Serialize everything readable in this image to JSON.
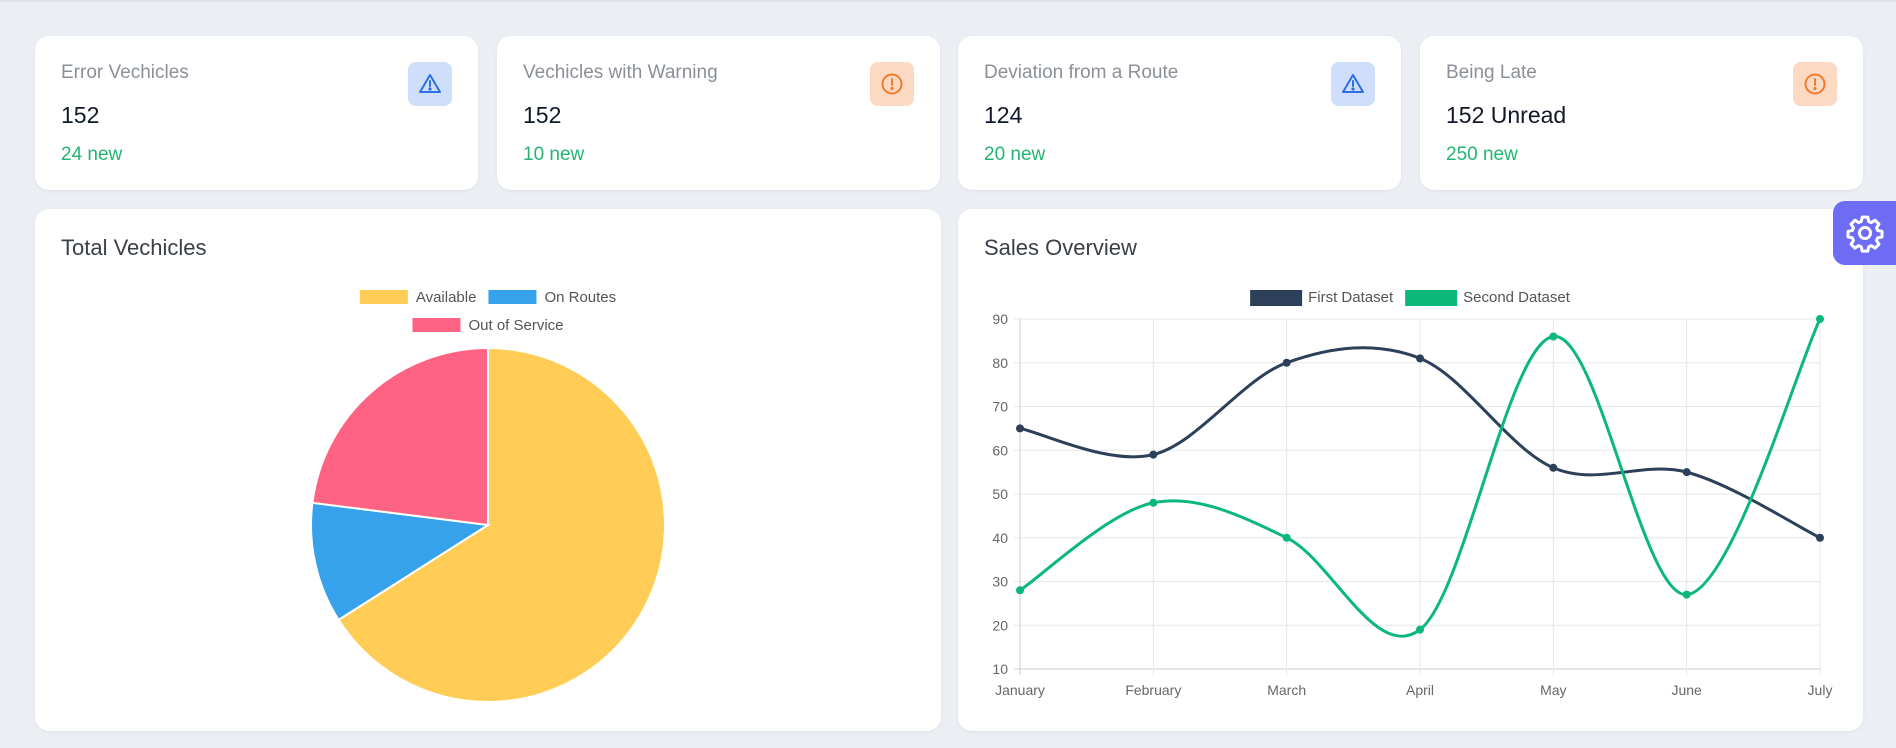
{
  "stats": [
    {
      "title": "Error Vechicles",
      "value": "152",
      "new": "24 new",
      "icon": "warning-triangle-icon",
      "icon_color": "#2f6fe4",
      "icon_bg": "#cfdffb"
    },
    {
      "title": "Vechicles with Warning",
      "value": "152",
      "new": "10 new",
      "icon": "exclamation-circle-icon",
      "icon_color": "#f07c2f",
      "icon_bg": "#fbd9c2"
    },
    {
      "title": "Deviation from a Route",
      "value": "124",
      "new": "20 new",
      "icon": "warning-triangle-icon",
      "icon_color": "#2f6fe4",
      "icon_bg": "#cfdffb"
    },
    {
      "title": "Being Late",
      "value": "152 Unread",
      "new": "250 new",
      "icon": "exclamation-circle-icon",
      "icon_color": "#f07c2f",
      "icon_bg": "#fbd9c2"
    }
  ],
  "pie_card": {
    "title": "Total Vechicles"
  },
  "line_card": {
    "title": "Sales Overview"
  },
  "settings": {
    "icon": "gear-icon"
  },
  "colors": {
    "accent": "#6e6cf4",
    "positive": "#22b573"
  },
  "chart_data": [
    {
      "type": "pie",
      "title": "",
      "legend_position": "top",
      "categories": [
        "Available",
        "On Routes",
        "Out of Service"
      ],
      "values": [
        66,
        11,
        23
      ],
      "colors": [
        "#ffcd56",
        "#36a2eb",
        "#ff6384"
      ]
    },
    {
      "type": "line",
      "title": "",
      "legend_position": "top",
      "smooth": true,
      "grid": true,
      "x": [
        "January",
        "February",
        "March",
        "April",
        "May",
        "June",
        "July"
      ],
      "ylim": [
        10,
        90
      ],
      "yticks": [
        10,
        20,
        30,
        40,
        50,
        60,
        70,
        80,
        90
      ],
      "series": [
        {
          "name": "First Dataset",
          "color": "#2c405a",
          "values": [
            65,
            59,
            80,
            81,
            56,
            55,
            40
          ]
        },
        {
          "name": "Second Dataset",
          "color": "#0bb87a",
          "values": [
            28,
            48,
            40,
            19,
            86,
            27,
            90
          ]
        }
      ]
    }
  ]
}
